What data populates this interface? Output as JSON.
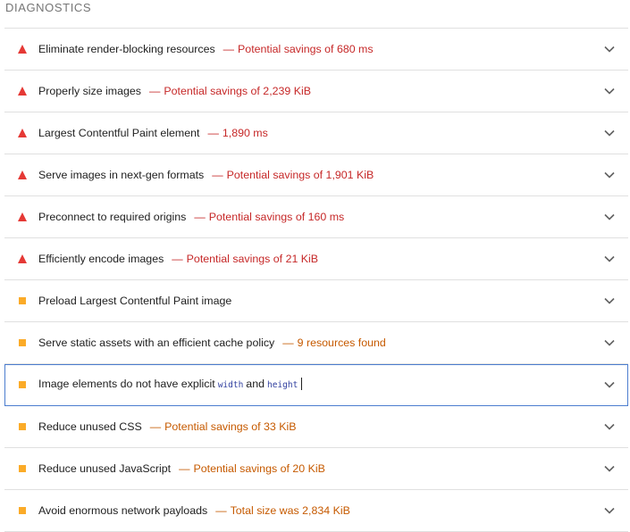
{
  "section": {
    "title": "DIAGNOSTICS"
  },
  "audits": [
    {
      "status": "fail",
      "title": "Eliminate render-blocking resources",
      "detail": "Potential savings of 680 ms"
    },
    {
      "status": "fail",
      "title": "Properly size images",
      "detail": "Potential savings of 2,239 KiB"
    },
    {
      "status": "fail",
      "title": "Largest Contentful Paint element",
      "detail": "1,890 ms"
    },
    {
      "status": "fail",
      "title": "Serve images in next-gen formats",
      "detail": "Potential savings of 1,901 KiB"
    },
    {
      "status": "fail",
      "title": "Preconnect to required origins",
      "detail": "Potential savings of 160 ms"
    },
    {
      "status": "fail",
      "title": "Efficiently encode images",
      "detail": "Potential savings of 21 KiB"
    },
    {
      "status": "average",
      "title": "Preload Largest Contentful Paint image",
      "detail": ""
    },
    {
      "status": "average",
      "title": "Serve static assets with an efficient cache policy",
      "detail": "9 resources found"
    },
    {
      "status": "average",
      "title_prefix": "Image elements do not have explicit",
      "code1": "width",
      "and": "and",
      "code2": "height",
      "detail": ""
    },
    {
      "status": "average",
      "title": "Reduce unused CSS",
      "detail": "Potential savings of 33 KiB"
    },
    {
      "status": "average",
      "title": "Reduce unused JavaScript",
      "detail": "Potential savings of 20 KiB"
    },
    {
      "status": "average",
      "title": "Avoid enormous network payloads",
      "detail": "Total size was 2,834 KiB"
    }
  ],
  "separator": "—",
  "colors": {
    "fail": "#e53935",
    "average": "#fbab28",
    "fail_text": "#c62828",
    "average_text": "#c65a00",
    "focus_outline": "#4c7dcf"
  },
  "icons": {
    "fail": "warning-triangle-icon",
    "average": "orange-square-icon",
    "expand": "chevron-down-icon"
  }
}
